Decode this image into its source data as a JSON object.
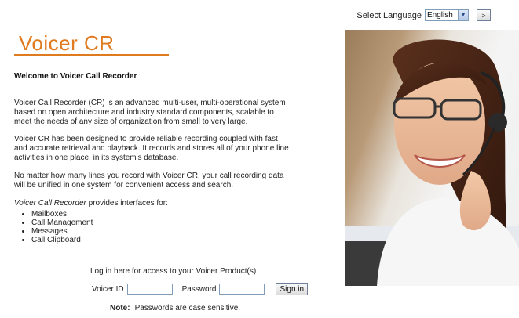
{
  "language": {
    "label": "Select Language",
    "selected": "English",
    "go_label": ">"
  },
  "brand": {
    "title": "Voicer CR",
    "accent": "#e07a1e"
  },
  "content": {
    "welcome": "Welcome to Voicer Call Recorder",
    "paragraphs": [
      "Voicer Call Recorder (CR) is an advanced multi-user, multi-operational system based on open architecture and industry standard components, scalable to meet the needs of any size of organization from small to very large.",
      "Voicer CR has been designed to provide reliable recording coupled with fast and accurate retrieval and playback. It records and stores all of your phone line activities in one place, in its system's database.",
      "No matter how many lines you record with Voicer CR, your call recording data will be unified in one system for convenient access and search."
    ],
    "intro_em": "Voicer Call Recorder",
    "intro_rest": " provides interfaces for:",
    "interfaces": [
      "Mailboxes",
      "Call Management",
      "Messages",
      "Call Clipboard"
    ]
  },
  "login": {
    "prompt": "Log in here for access to your Voicer Product(s)",
    "id_label": "Voicer ID",
    "password_label": "Password",
    "signin_label": "Sign in",
    "note_label": "Note:",
    "note_text": "Passwords are case sensitive."
  }
}
